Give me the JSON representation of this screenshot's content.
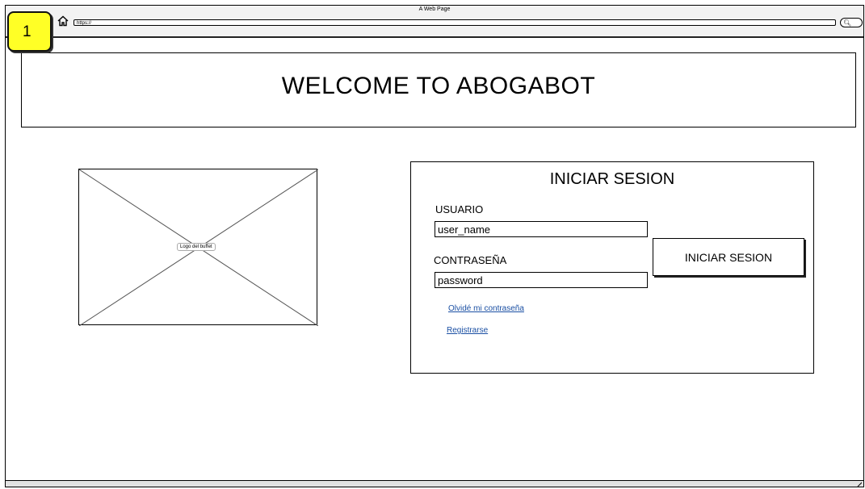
{
  "browser": {
    "page_title": "A Web Page",
    "url": "https://",
    "icons": {
      "home": "home-icon",
      "search": "search-icon"
    }
  },
  "badge": {
    "number": "1",
    "color": "#ffff26"
  },
  "header": {
    "title": "WELCOME TO ABOGABOT"
  },
  "logo": {
    "label": "Logo del buffet"
  },
  "login": {
    "title": "INICIAR SESION",
    "username_label": "USUARIO",
    "username_value": "user_name",
    "password_label": "CONTRASEÑA",
    "password_value": "password",
    "submit_label": "INICIAR SESION",
    "forgot_link": "Olvidé mi contraseña",
    "register_link": "Registrarse",
    "link_color": "#1a4fa3"
  }
}
